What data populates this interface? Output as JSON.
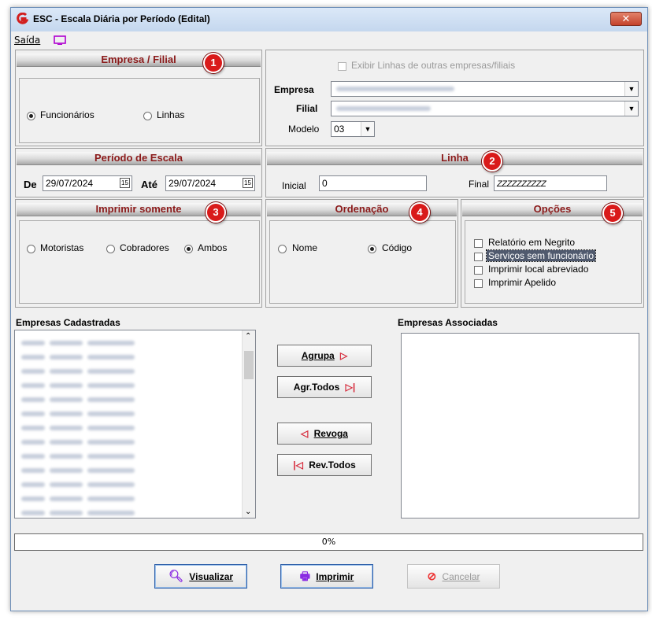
{
  "window": {
    "title": "ESC - Escala Diária por Período (Edital)",
    "close_label": "✕"
  },
  "menu": {
    "saida": "Saída"
  },
  "empresa_filial": {
    "header": "Empresa / Filial",
    "badge": "1",
    "radio_funcionarios": "Funcionários",
    "radio_linhas": "Linhas",
    "exibir_linhas_label": "Exibir Linhas de outras empresas/filiais",
    "empresa_label": "Empresa",
    "filial_label": "Filial",
    "modelo_label": "Modelo",
    "modelo_value": "03"
  },
  "periodo": {
    "header": "Período de Escala",
    "de_label": "De",
    "de_value": "29/07/2024",
    "ate_label": "Até",
    "ate_value": "29/07/2024"
  },
  "linha": {
    "header": "Linha",
    "badge": "2",
    "inicial_label": "Inicial",
    "inicial_value": "0",
    "final_label": "Final",
    "final_value": "ZZZZZZZZZZ"
  },
  "imprimir": {
    "header": "Imprimir somente",
    "badge": "3",
    "opt1": "Motoristas",
    "opt2": "Cobradores",
    "opt3": "Ambos",
    "selected": "Ambos"
  },
  "ordenacao": {
    "header": "Ordenação",
    "badge": "4",
    "opt1": "Nome",
    "opt2": "Código",
    "selected": "Código"
  },
  "opcoes": {
    "header": "Opções",
    "badge": "5",
    "items": [
      "Relatório em Negrito",
      "Serviços sem funcionário",
      "Imprimir local abreviado",
      "Imprimir Apelido"
    ]
  },
  "lists": {
    "cadastradas_label": "Empresas Cadastradas",
    "associadas_label": "Empresas Associadas"
  },
  "buttons": {
    "agrupa": "Agrupa",
    "agr_todos": "Agr.Todos",
    "revoga": "Revoga",
    "rev_todos": "Rev.Todos",
    "visualizar": "Visualizar",
    "imprimir": "Imprimir",
    "cancelar": "Cancelar"
  },
  "progress": {
    "text": "0%",
    "value": 0
  },
  "colors": {
    "header_text": "#8b1a1a",
    "badge": "#d91a1a",
    "accent": "#2b5da8"
  }
}
